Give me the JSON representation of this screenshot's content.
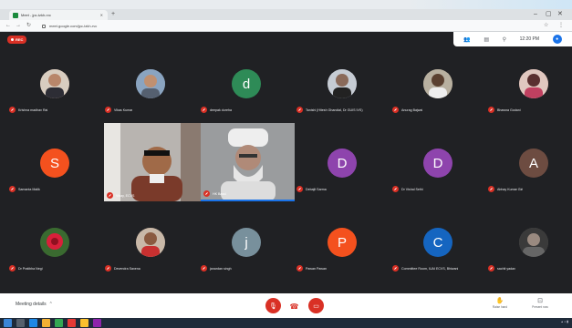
{
  "browser": {
    "tab_title": "Meet - jpc-tzkh-rvc",
    "address": "meet.google.com/jpc-tzkh-rvc"
  },
  "meet": {
    "rec_label": "REC",
    "clock": "12:20 PM"
  },
  "participants": [
    {
      "name": "Krishna madhav Rai",
      "initial": "",
      "color": "#7a5a48"
    },
    {
      "name": "Vikas Kumar",
      "initial": "",
      "color": "#6b7f9a"
    },
    {
      "name": "deepak dureha",
      "initial": "d",
      "color": "#2e8b57"
    },
    {
      "name": "Tanishi (Hitesh Ghandial, Dr GUIS IVS)",
      "initial": "",
      "color": "#556"
    },
    {
      "name": "Anurag Bajwai",
      "initial": "",
      "color": "#8a8070"
    },
    {
      "name": "Bhawna Godani",
      "initial": "",
      "color": "#a06058"
    },
    {
      "name": "Samanta Malik",
      "initial": "S",
      "color": "#f4511e"
    },
    {
      "name": "Debajit Sarma",
      "initial": "D",
      "color": "#8e44ad"
    },
    {
      "name": "Dr Vishal Sethi",
      "initial": "D",
      "color": "#8e44ad"
    },
    {
      "name": "Abhay Kumar Giri",
      "initial": "A",
      "color": "#6d4c41"
    },
    {
      "name": "Dr Pratibha Negi",
      "initial": "",
      "color": "#c03040"
    },
    {
      "name": "Devendra Saxena",
      "initial": "",
      "color": "#7a5548"
    },
    {
      "name": "janardan singh",
      "initial": "j",
      "color": "#78909c"
    },
    {
      "name": "Pawan Pawan",
      "initial": "P",
      "color": "#f4511e"
    },
    {
      "name": "Committee Room, IUAI ECVS, Bhiwani",
      "initial": "C",
      "color": "#1565c0"
    },
    {
      "name": "sachit yadav",
      "initial": "",
      "color": "#5a5a5a"
    }
  ],
  "video_tiles": [
    {
      "name": "Vinay, ECVS"
    },
    {
      "name": "HK Bassi"
    }
  ],
  "bottom": {
    "meeting_details": "Meeting details",
    "raise_hand": "Raise hand",
    "present_now": "Present now"
  },
  "colors": {
    "meet_bg": "#202124",
    "accent_red": "#d93025",
    "accent_blue": "#1a73e8"
  }
}
